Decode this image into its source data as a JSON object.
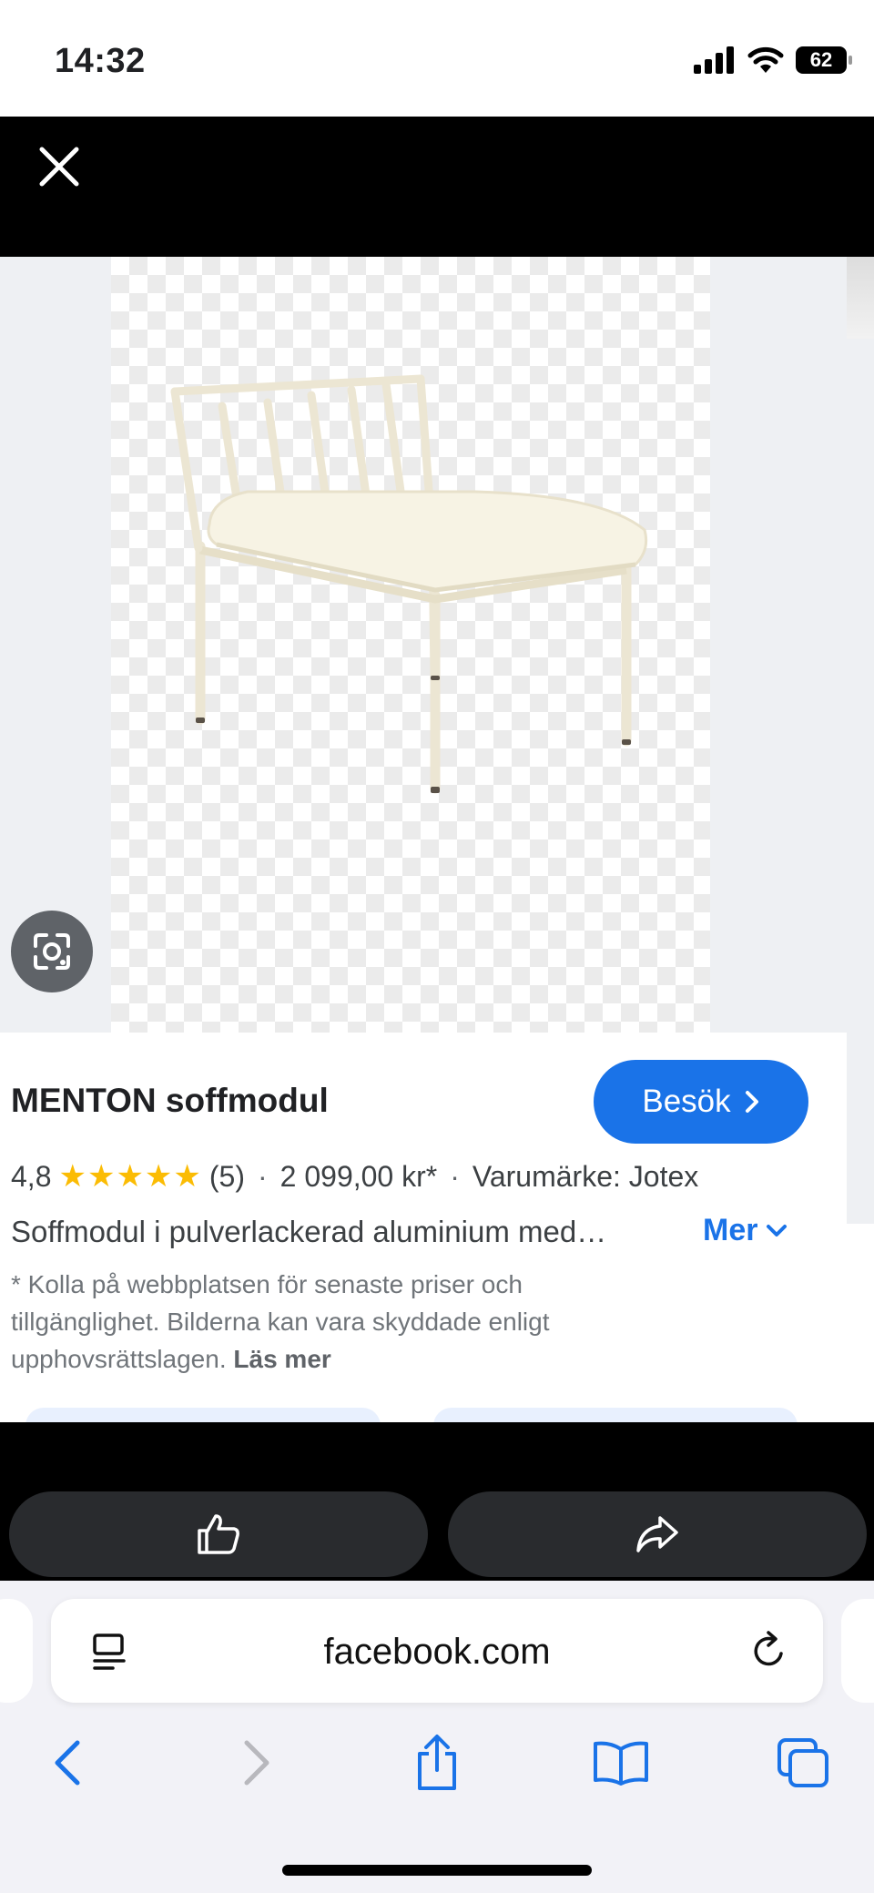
{
  "status_bar": {
    "time": "14:32",
    "battery": "62"
  },
  "viewer": {
    "close_icon": "close-icon",
    "lens_icon": "google-lens-icon"
  },
  "product": {
    "title": "MENTON soffmodul",
    "visit_label": "Besök",
    "rating": "4,8",
    "stars": "★★★★★",
    "review_count": "(5)",
    "price": "2 099,00 kr*",
    "brand": "Varumärke: Jotex",
    "separator": "·",
    "description": "Soffmodul i pulverlackerad aluminium med…",
    "more_label": "Mer",
    "disclaimer": "* Kolla på webbplatsen för senaste priser och tillgänglighet. Bilderna kan vara skyddade enligt upphovsrättslagen.",
    "read_more": "Läs mer"
  },
  "actions": {
    "like_icon": "thumbs-up-icon",
    "share_icon": "share-arrow-icon"
  },
  "browser": {
    "url": "facebook.com",
    "nav": [
      "back-icon",
      "forward-icon",
      "share-icon",
      "bookmarks-icon",
      "tabs-icon"
    ]
  },
  "colors": {
    "accent": "#1a73e8",
    "star": "#fbbc04",
    "dark_button": "#292b2e"
  }
}
